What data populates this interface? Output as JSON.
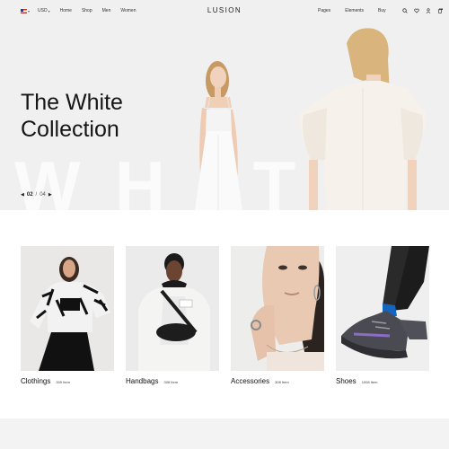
{
  "header": {
    "currency": "USD",
    "nav_left": [
      "Home",
      "Shop",
      "Men",
      "Women"
    ],
    "brand": "LUSION",
    "nav_right": [
      "Pages",
      "Elements",
      "Buy"
    ],
    "icons": [
      "search-icon",
      "heart-icon",
      "user-icon",
      "cart-icon"
    ]
  },
  "hero": {
    "title_line1": "The White",
    "title_line2": "Collection",
    "background_word": "WHITE",
    "pager_current": "02",
    "pager_separator": "/",
    "pager_total": "04"
  },
  "categories": [
    {
      "name": "Clothings",
      "count": "309 Item"
    },
    {
      "name": "Handbags",
      "count": "308 Item"
    },
    {
      "name": "Accessories",
      "count": "308 Item"
    },
    {
      "name": "Shoes",
      "count": "1008 Item"
    }
  ],
  "colors": {
    "hero_bg": "#f0f0f1",
    "text": "#151515",
    "footer_band": "#f3f3f3"
  }
}
